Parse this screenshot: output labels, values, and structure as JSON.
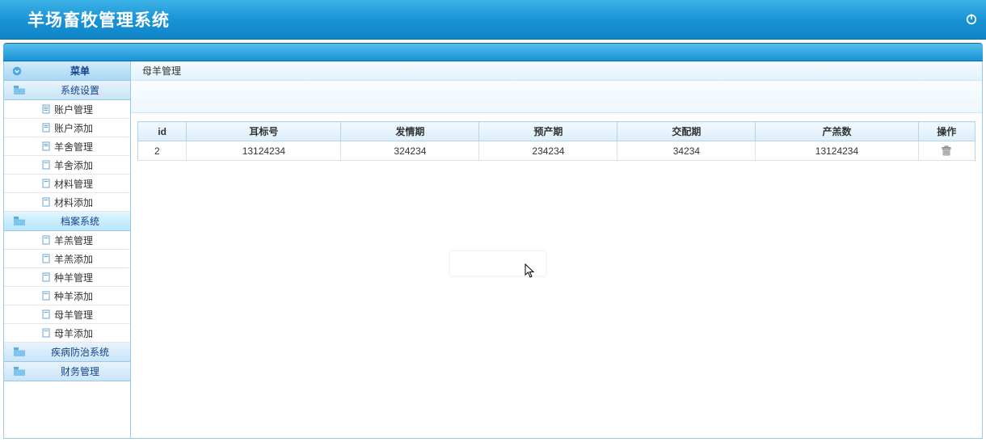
{
  "header": {
    "title": "羊场畜牧管理系统"
  },
  "sidebar": {
    "menu_label": "菜单",
    "categories": [
      {
        "label": "系统设置",
        "items": [
          {
            "label": "账户管理"
          },
          {
            "label": "账户添加"
          },
          {
            "label": "羊舍管理"
          },
          {
            "label": "羊舍添加"
          },
          {
            "label": "材料管理"
          },
          {
            "label": "材料添加"
          }
        ]
      },
      {
        "label": "档案系统",
        "selected": true,
        "items": [
          {
            "label": "羊羔管理"
          },
          {
            "label": "羊羔添加"
          },
          {
            "label": "种羊管理"
          },
          {
            "label": "种羊添加"
          },
          {
            "label": "母羊管理"
          },
          {
            "label": "母羊添加"
          }
        ]
      },
      {
        "label": "疾病防治系统",
        "items": []
      },
      {
        "label": "财务管理",
        "items": []
      }
    ]
  },
  "content": {
    "title": "母羊管理",
    "columns": [
      "id",
      "耳标号",
      "发情期",
      "预产期",
      "交配期",
      "产羔数",
      "操作"
    ],
    "rows": [
      {
        "id": "2",
        "ear": "13124234",
        "estrus": "324234",
        "due": "234234",
        "mate": "34234",
        "lamb": "13124234"
      }
    ]
  }
}
